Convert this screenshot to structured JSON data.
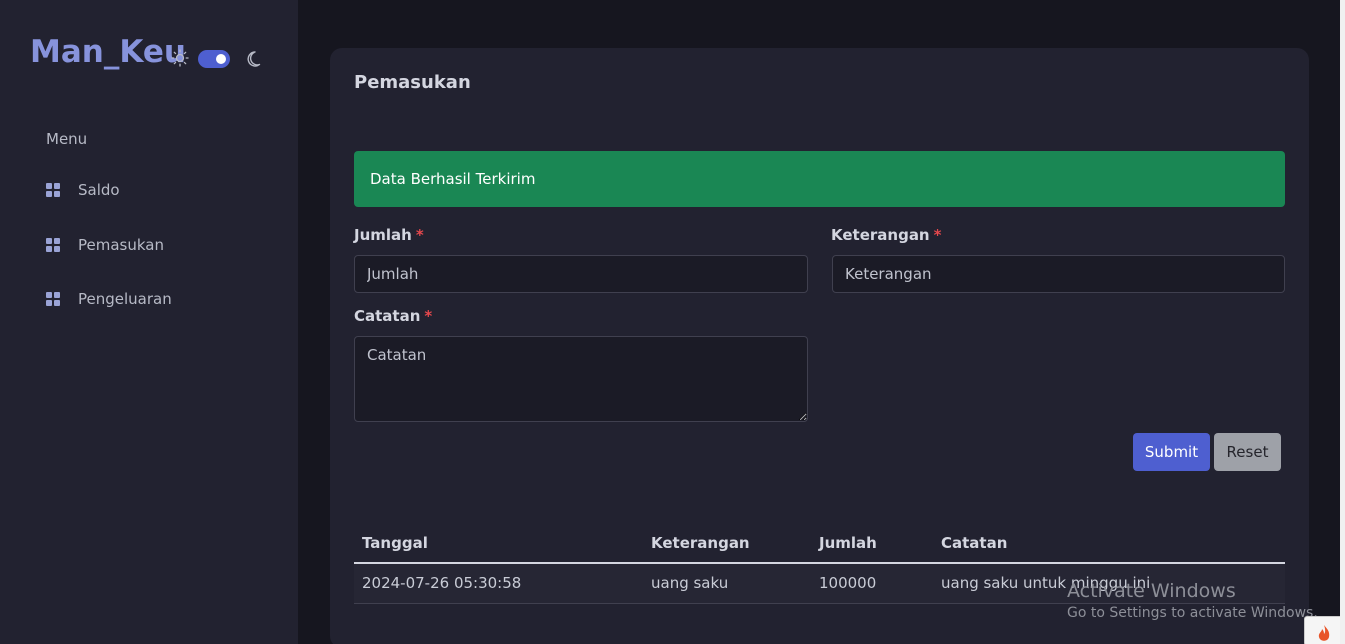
{
  "sidebar": {
    "brand": "Man_Keu",
    "menu_title": "Menu",
    "items": [
      {
        "label": "Saldo",
        "icon": "grid-icon"
      },
      {
        "label": "Pemasukan",
        "icon": "grid-icon"
      },
      {
        "label": "Pengeluaran",
        "icon": "grid-icon"
      }
    ],
    "theme_toggle": {
      "state": "dark",
      "left_icon": "sun-icon",
      "right_icon": "moon-icon"
    }
  },
  "main": {
    "title": "Pemasukan",
    "alert": "Data Berhasil Terkirim",
    "form": {
      "jumlah": {
        "label": "Jumlah",
        "required": "*",
        "placeholder": "Jumlah"
      },
      "keterangan": {
        "label": "Keterangan",
        "required": "*",
        "placeholder": "Keterangan"
      },
      "catatan": {
        "label": "Catatan",
        "required": "*",
        "placeholder": "Catatan"
      },
      "submit_label": "Submit",
      "reset_label": "Reset"
    },
    "table": {
      "columns": [
        "Tanggal",
        "Keterangan",
        "Jumlah",
        "Catatan"
      ],
      "rows": [
        [
          "2024-07-26 05:30:58",
          "uang saku",
          "100000",
          "uang saku untuk minggu ini"
        ]
      ]
    }
  },
  "watermark": {
    "line1": "Activate Windows",
    "line2": "Go to Settings to activate Windows."
  },
  "colors": {
    "accent": "#4e5fd0",
    "brand": "#8793dc",
    "success": "#1a8754",
    "required": "#e5484d"
  }
}
